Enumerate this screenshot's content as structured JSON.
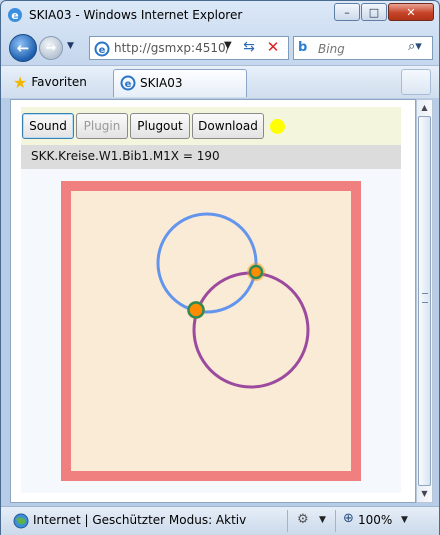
{
  "window": {
    "title": "SKIA03 - Windows Internet Explorer",
    "minimize_symbol": "–",
    "maximize_symbol": "□",
    "close_symbol": "✕"
  },
  "nav": {
    "back_symbol": "←",
    "forward_symbol": "→",
    "dropdown_symbol": "▼",
    "address": "http://gsmxp:4510/",
    "address_dropdown_symbol": "▼",
    "refresh_symbol": "⇆",
    "stop_symbol": "✕",
    "search_brand": "b",
    "search_placeholder": "Bing",
    "search_button_symbol": "⌕",
    "search_dropdown_symbol": "▾"
  },
  "favorites_bar": {
    "favorites_label": "Favoriten",
    "tab_label": "SKIA03"
  },
  "page": {
    "buttons": {
      "sound": "Sound",
      "plugin": "Plugin",
      "plugout": "Plugout",
      "download": "Download"
    },
    "indicator_color": "#ffff00",
    "status_text": "SKK.Kreise.W1.Bib1.M1X = 190",
    "colors": {
      "frame": "#f08080",
      "background": "#faebd7",
      "circle1": "#6495ed",
      "circle2": "#9b4a9e",
      "intersection_fill": "#ff8c00",
      "intersection_outline": "#2e8b57"
    }
  },
  "statusbar": {
    "zone_text": "Internet | Geschützter Modus: Aktiv",
    "zoom": "100%",
    "dropdown_symbol": "▼"
  }
}
